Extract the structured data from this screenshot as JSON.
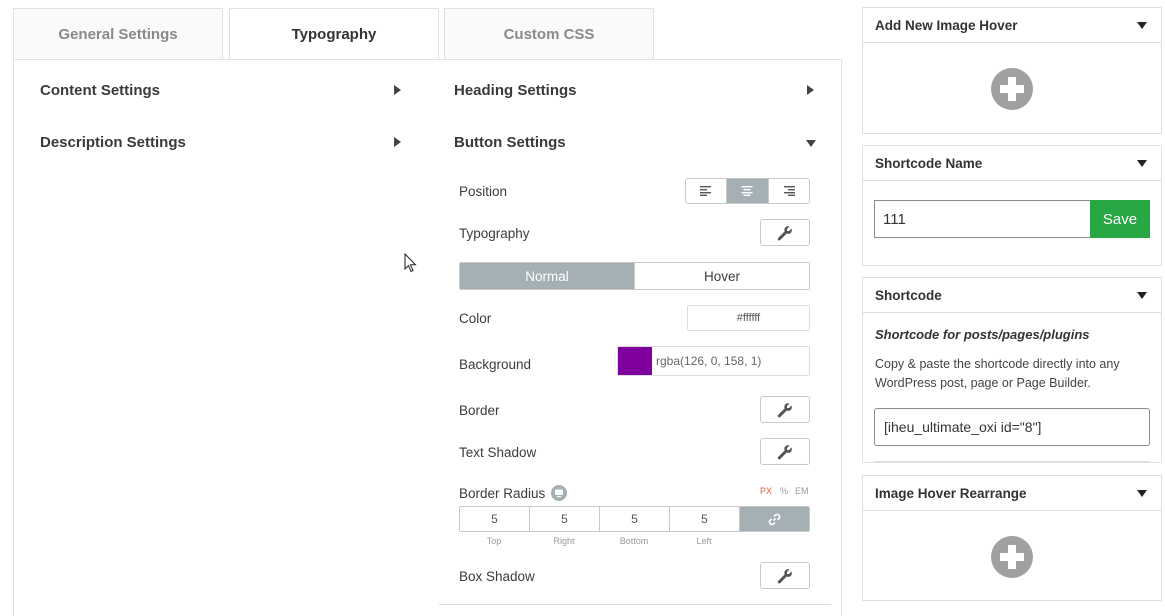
{
  "tabs": [
    {
      "label": "General Settings",
      "active": false
    },
    {
      "label": "Typography",
      "active": true
    },
    {
      "label": "Custom CSS",
      "active": false
    }
  ],
  "sections": {
    "content": "Content Settings",
    "description": "Description Settings",
    "heading": "Heading Settings",
    "button": "Button Settings"
  },
  "button_settings": {
    "position_label": "Position",
    "typography_label": "Typography",
    "state_normal": "Normal",
    "state_hover": "Hover",
    "color_label": "Color",
    "color_value": "#ffffff",
    "background_label": "Background",
    "background_value": "rgba(126, 0, 158, 1)",
    "background_swatch": "#7e009e",
    "border_label": "Border",
    "text_shadow_label": "Text Shadow",
    "border_radius_label": "Border Radius",
    "units": [
      "PX",
      "%",
      "EM"
    ],
    "radius_values": [
      "5",
      "5",
      "5",
      "5"
    ],
    "radius_labels": [
      "Top",
      "Right",
      "Bottom",
      "Left"
    ],
    "box_shadow_label": "Box Shadow"
  },
  "sidebar": {
    "add_new_title": "Add New Image Hover",
    "shortcode_name_title": "Shortcode Name",
    "shortcode_name_value": "111",
    "save_label": "Save",
    "shortcode_title": "Shortcode",
    "shortcode_subtitle": "Shortcode for posts/pages/plugins",
    "shortcode_desc": "Copy & paste the shortcode directly into any WordPress post, page or Page Builder.",
    "shortcode_value": "[iheu_ultimate_oxi id=\"8\"]",
    "rearrange_title": "Image Hover Rearrange"
  },
  "colors": {
    "accent_grey": "#a5b0b5",
    "save_green": "#28a745",
    "unit_active": "#e55b3c"
  }
}
